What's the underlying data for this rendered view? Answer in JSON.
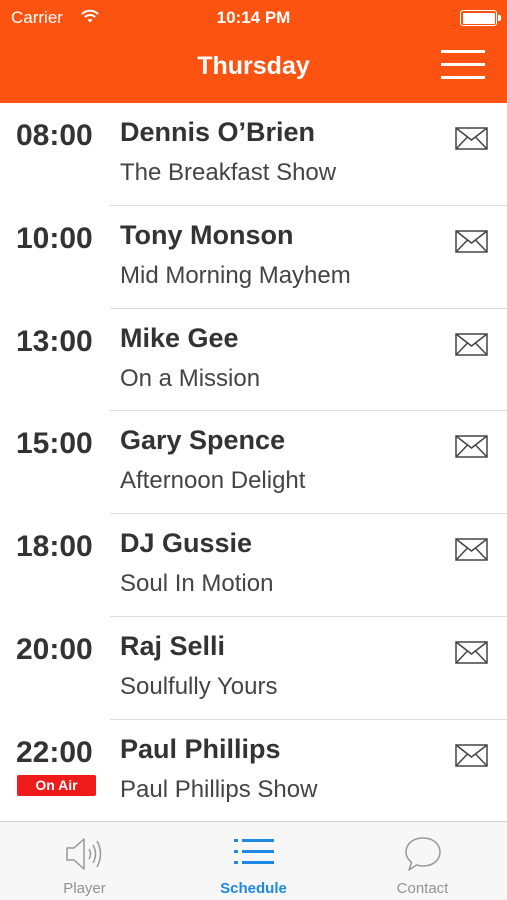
{
  "status_bar": {
    "carrier": "Carrier",
    "time": "10:14 PM"
  },
  "nav": {
    "title": "Thursday"
  },
  "schedule": [
    {
      "time": "08:00",
      "presenter": "Dennis O’Brien",
      "show": "The Breakfast Show"
    },
    {
      "time": "10:00",
      "presenter": "Tony Monson",
      "show": "Mid Morning Mayhem"
    },
    {
      "time": "13:00",
      "presenter": "Mike Gee",
      "show": "On a Mission"
    },
    {
      "time": "15:00",
      "presenter": "Gary Spence",
      "show": "Afternoon Delight"
    },
    {
      "time": "18:00",
      "presenter": "DJ Gussie",
      "show": "Soul In Motion"
    },
    {
      "time": "20:00",
      "presenter": "Raj Selli",
      "show": "Soulfully Yours"
    },
    {
      "time": "22:00",
      "presenter": "Paul Phillips",
      "show": "Paul Phillips Show"
    }
  ],
  "on_air_label": "On Air",
  "tabs": [
    {
      "label": "Player",
      "icon": "speaker-icon"
    },
    {
      "label": "Schedule",
      "icon": "list-icon"
    },
    {
      "label": "Contact",
      "icon": "chat-bubble-icon"
    }
  ],
  "colors": {
    "brand": "#fc5410",
    "active_tab": "#1e88e5",
    "on_air": "#ef1a1a"
  }
}
